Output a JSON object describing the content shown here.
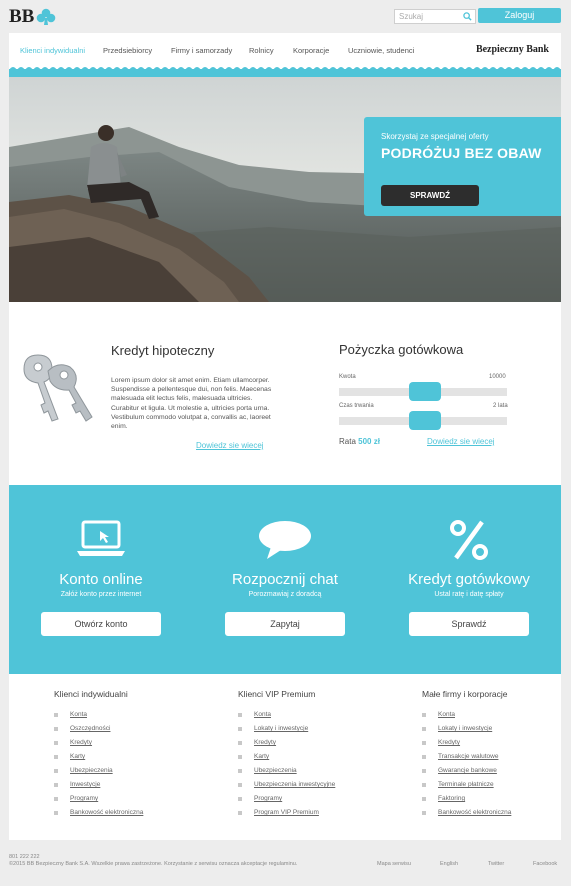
{
  "brand": {
    "logo_text": "BB",
    "bank_name": "Bezpieczny Bank"
  },
  "search": {
    "placeholder": "Szukaj"
  },
  "login": {
    "label": "Zaloguj"
  },
  "nav": {
    "items": [
      "Klienci indywidualni",
      "Przedsiebiorcy",
      "Firmy i samorzady",
      "Rolnicy",
      "Korporacje",
      "Uczniowie, studenci"
    ]
  },
  "hero": {
    "promo_subtitle": "Skorzystaj ze specjalnej oferty",
    "promo_title": "PODRÓŻUJ BEZ OBAW",
    "promo_button": "SPRAWDŹ"
  },
  "mortgage": {
    "title": "Kredyt hipoteczny",
    "text": "Lorem ipsum dolor sit amet enim. Etiam ullamcorper. Suspendisse a pellentesque dui, non felis. Maecenas malesuada elit lectus felis, malesuada ultricies. Curabitur et ligula. Ut molestie a, ultricies porta urna. Vestibulum commodo volutpat a, convallis ac, laoreet enim.",
    "link": "Dowiedz sie wiecej"
  },
  "loan": {
    "title": "Pożyczka gotówkowa",
    "amount_label": "Kwota",
    "amount_max": "10000",
    "amount_level": 0.5,
    "term_label": "Czas trwania",
    "term_max": "2 lata",
    "term_level": 0.5,
    "rate_label": "Rata",
    "rate_value": "500 zł",
    "link": "Dowiedz sie wiecej"
  },
  "features": [
    {
      "icon": "laptop-icon",
      "title": "Konto online",
      "subtitle": "Załóż konto przez internet",
      "button": "Otwórz konto"
    },
    {
      "icon": "chat-bubble-icon",
      "title": "Rozpocznij chat",
      "subtitle": "Porozmawiaj z doradcą",
      "button": "Zapytaj"
    },
    {
      "icon": "percent-icon",
      "title": "Kredyt gotówkowy",
      "subtitle": "Ustal ratę i datę spłaty",
      "button": "Sprawdź"
    }
  ],
  "link_columns": [
    {
      "title": "Klienci indywidualni",
      "items": [
        "Konta",
        "Oszczędności",
        "Kredyty",
        "Karty",
        "Ubezpieczenia",
        "Inwestycje",
        "Programy",
        "Bankowość elektroniczna"
      ]
    },
    {
      "title": "Klienci VIP Premium",
      "items": [
        "Konta",
        "Lokaty i inwestycje",
        "Kredyty",
        "Karty",
        "Ubezpieczenia",
        "Ubezpieczenia inwestycyjne",
        "Programy",
        "Program VIP Premium"
      ]
    },
    {
      "title": "Małe firmy i korporacje",
      "items": [
        "Konta",
        "Lokaty i inwestycje",
        "Kredyty",
        "Transakcje walutowe",
        "Gwarancje bankowe",
        "Terminale płatnicze",
        "Faktoring",
        "Bankowość elektroniczna"
      ]
    }
  ],
  "footer": {
    "phone": "801 222 222",
    "copyright": "©2015 BB Bezpieczny Bank S.A. Wszelkie prawa zastrzeżone. Korzystanie z serwisu oznacza akceptacje regulaminu.",
    "links": [
      "Mapa serwisu",
      "English",
      "Twitter",
      "Facebook"
    ]
  },
  "colors": {
    "accent": "#4fc4d8",
    "dark_button": "#2d2d2d",
    "page_bg": "#ededed"
  }
}
